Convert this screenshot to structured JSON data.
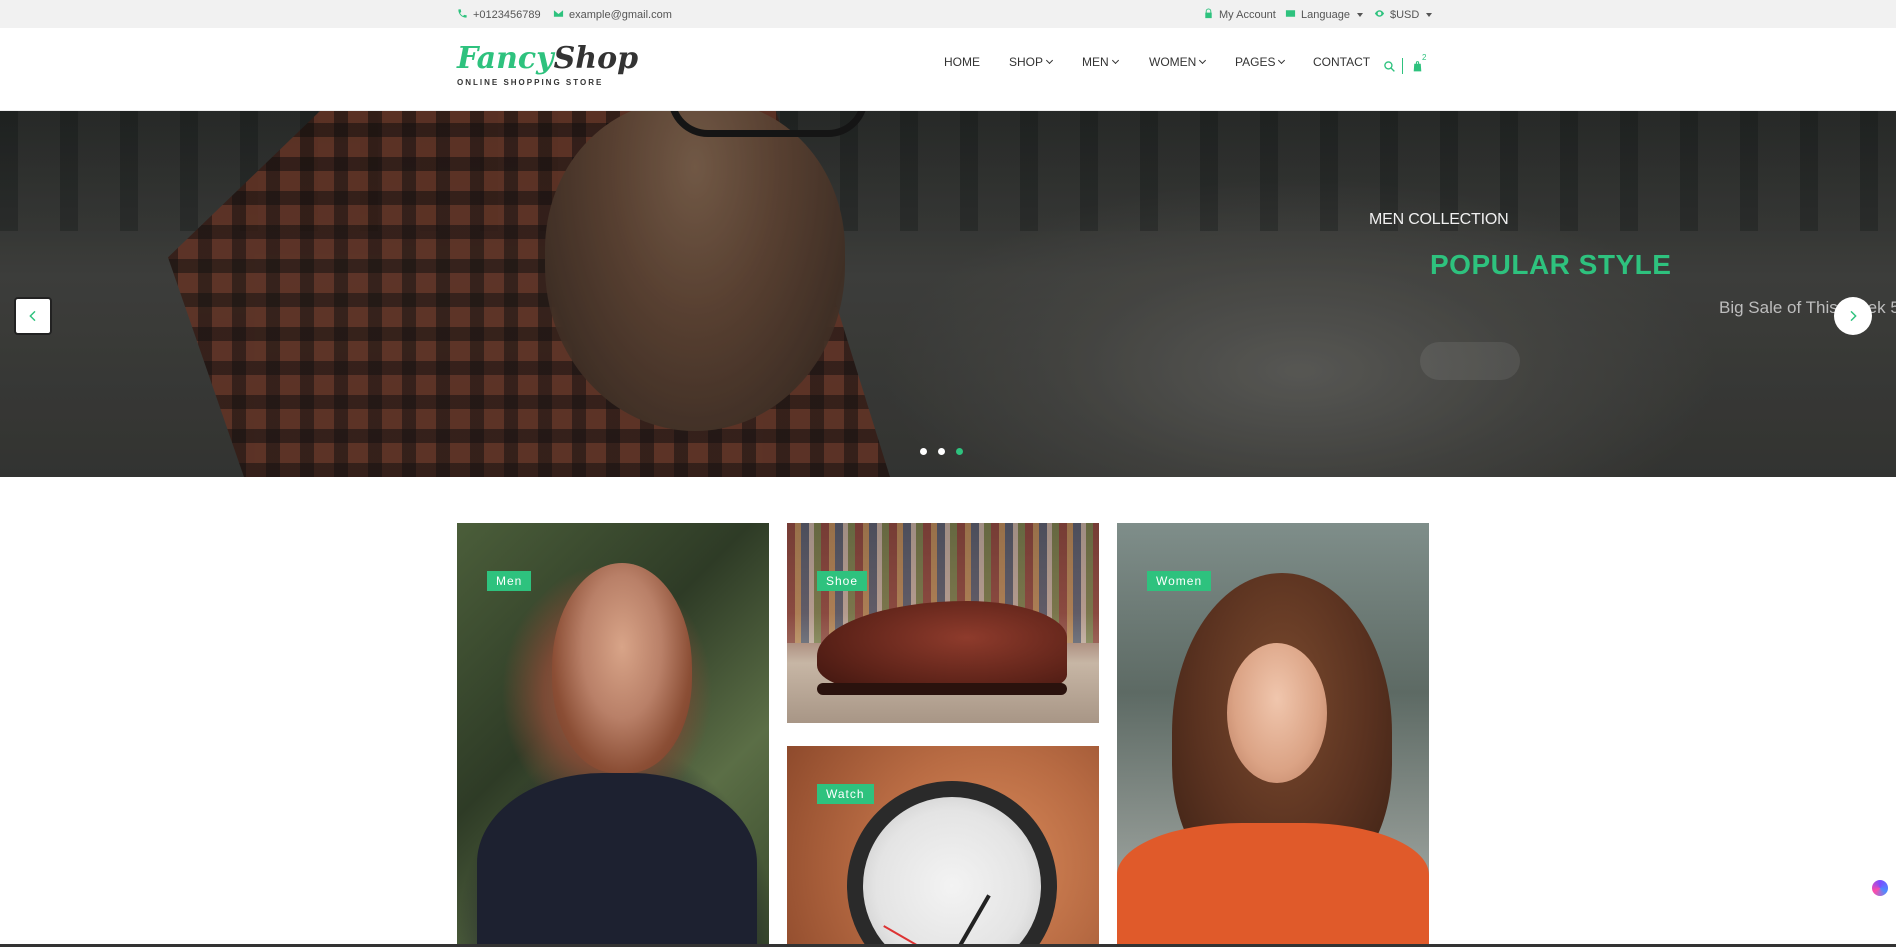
{
  "topbar": {
    "phone": "+0123456789",
    "email": "example@gmail.com",
    "account": "My Account",
    "language": "Language",
    "currency": "$USD"
  },
  "logo": {
    "word1": "Fancy",
    "word2": "Shop",
    "tagline": "ONLINE SHOPPING STORE"
  },
  "nav": {
    "items": [
      "HOME",
      "SHOP",
      "MEN",
      "WOMEN",
      "PAGES",
      "CONTACT"
    ],
    "cart_count": "2"
  },
  "hero": {
    "subtitle": "MEN COLLECTION",
    "title": "POPULAR STYLE",
    "description": "Big Sale of This Week 5",
    "slides_total": 3,
    "active_slide": 3
  },
  "categories": [
    "Men",
    "Shoe",
    "Watch",
    "Women"
  ],
  "colors": {
    "accent": "#2ec27e",
    "topbar_bg": "#f1f1f1",
    "text": "#333333"
  },
  "icons": [
    "phone-icon",
    "mail-icon",
    "lock-icon",
    "language-icon",
    "currency-icon",
    "search-icon",
    "cart-icon",
    "chevron-left-icon",
    "chevron-right-icon"
  ]
}
